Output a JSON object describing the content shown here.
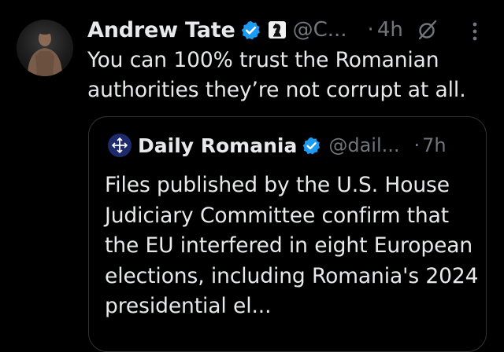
{
  "post": {
    "author_name": "Andrew Tate",
    "author_handle": "@C...",
    "time": "4h",
    "separator": "·",
    "text": "You can 100% trust the Romanian authorities they’re not corrupt at all.",
    "icons": {
      "verified": "verified-badge-icon",
      "affiliation": "chess-knight-icon",
      "grok": "grok-icon",
      "more": "more-options-icon"
    }
  },
  "quoted_post": {
    "author_name": "Daily Romania",
    "author_handle": "@dail...",
    "time": "7h",
    "separator": "·",
    "text": "Files published by the U.S. House Judiciary Committee confirm that the EU interfered in eight European elections, including Romania's 2024 presidential el..."
  },
  "colors": {
    "background": "#000000",
    "text": "#e7e9ea",
    "muted": "#71767b",
    "verified_blue": "#1d9bf0",
    "border": "#2f3336"
  }
}
